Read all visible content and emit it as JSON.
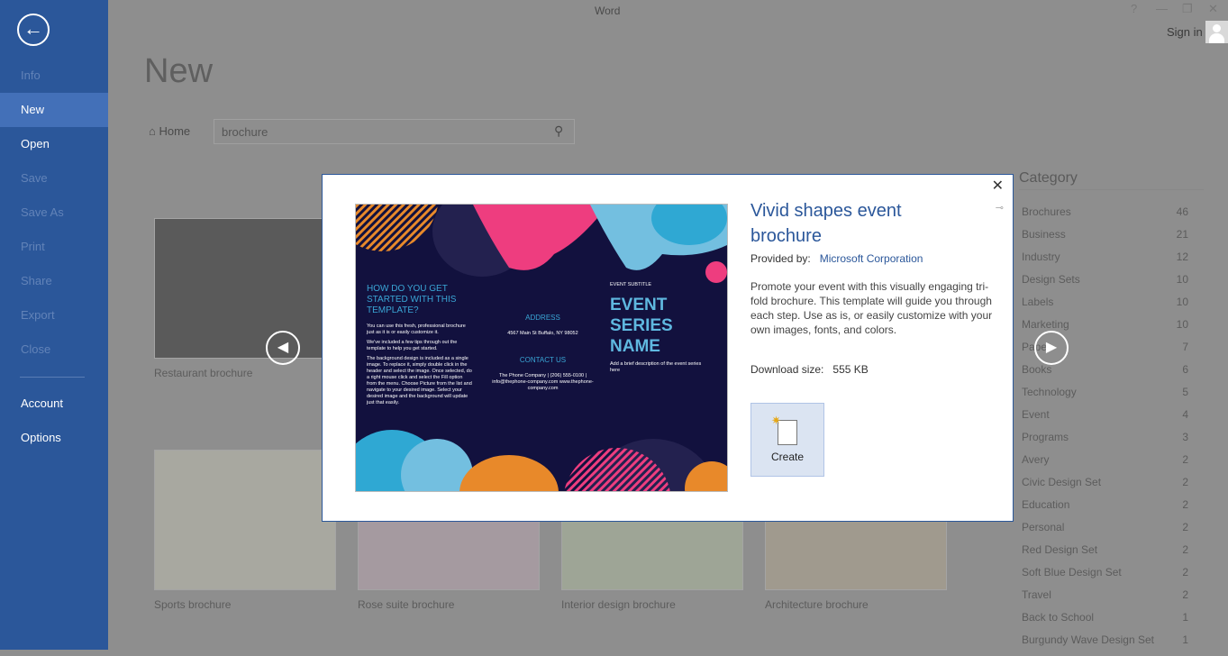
{
  "window": {
    "title": "Word",
    "help": "?",
    "minimize": "—",
    "restore": "❐",
    "close": "✕",
    "sign_in": "Sign in"
  },
  "sidebar": {
    "back_icon": "back-arrow-icon",
    "items": [
      {
        "label": "Info",
        "state": "disabled"
      },
      {
        "label": "New",
        "state": "selected"
      },
      {
        "label": "Open",
        "state": "normal"
      },
      {
        "label": "Save",
        "state": "disabled"
      },
      {
        "label": "Save As",
        "state": "disabled"
      },
      {
        "label": "Print",
        "state": "disabled"
      },
      {
        "label": "Share",
        "state": "disabled"
      },
      {
        "label": "Export",
        "state": "disabled"
      },
      {
        "label": "Close",
        "state": "disabled"
      },
      {
        "label": "Account",
        "state": "normal"
      },
      {
        "label": "Options",
        "state": "normal"
      }
    ]
  },
  "main": {
    "title": "New",
    "home": "Home",
    "search_value": "brochure",
    "templates": [
      {
        "label": "Restaurant brochure"
      },
      {
        "label": "Sports brochure"
      },
      {
        "label": "Rose suite brochure"
      },
      {
        "label": "Interior design brochure"
      },
      {
        "label": "Architecture brochure"
      }
    ]
  },
  "category": {
    "title": "Category",
    "items": [
      {
        "label": "Brochures",
        "count": "46"
      },
      {
        "label": "Business",
        "count": "21"
      },
      {
        "label": "Industry",
        "count": "12"
      },
      {
        "label": "Design Sets",
        "count": "10"
      },
      {
        "label": "Labels",
        "count": "10"
      },
      {
        "label": "Marketing",
        "count": "10"
      },
      {
        "label": "Paper",
        "count": "7"
      },
      {
        "label": "Books",
        "count": "6"
      },
      {
        "label": "Technology",
        "count": "5"
      },
      {
        "label": "Event",
        "count": "4"
      },
      {
        "label": "Programs",
        "count": "3"
      },
      {
        "label": "Avery",
        "count": "2"
      },
      {
        "label": "Civic Design Set",
        "count": "2"
      },
      {
        "label": "Education",
        "count": "2"
      },
      {
        "label": "Personal",
        "count": "2"
      },
      {
        "label": "Red Design Set",
        "count": "2"
      },
      {
        "label": "Soft Blue Design Set",
        "count": "2"
      },
      {
        "label": "Travel",
        "count": "2"
      },
      {
        "label": "Back to School",
        "count": "1"
      },
      {
        "label": "Burgundy Wave Design Set",
        "count": "1"
      }
    ]
  },
  "dialog": {
    "title": "Vivid shapes event brochure",
    "provided_by_label": "Provided by:",
    "provider": "Microsoft Corporation",
    "description": "Promote your event with this visually engaging tri-fold brochure. This template will guide you through each step. Use as is, or easily customize with your own images, fonts, and colors.",
    "download_label": "Download size:",
    "download_size": "555 KB",
    "create_label": "Create",
    "preview": {
      "heading": "HOW DO YOU GET STARTED WITH THIS TEMPLATE?",
      "p1": "You can use this fresh, professional brochure just as it is or easily customize it.",
      "p2": "We've included a few tips through out the template to help you get started.",
      "p3": "The background design is included as a single image. To replace it, simply double click in the header and select the image. Once selected, do a right mouse click and select the Fill option from the menu. Choose Picture from the list and navigate to your desired image. Select your desired image and the background will update just that easily.",
      "address_h": "ADDRESS",
      "address": "4567 Main St Buffalo, NY 98052",
      "contact_h": "CONTACT US",
      "contact": "The Phone Company | (206) 555-0100 | info@thephone-company.com www.thephone-company.com",
      "subtitle": "EVENT SUBTITLE",
      "name": "EVENT SERIES NAME",
      "brief": "Add a brief description of the event series here"
    }
  },
  "colors": {
    "accent": "#2b579a",
    "preview_bg": "#12113e",
    "pink": "#ee3d7f",
    "orange": "#e8892a",
    "blue": "#2fa8d3",
    "light_blue": "#73bfe0"
  }
}
